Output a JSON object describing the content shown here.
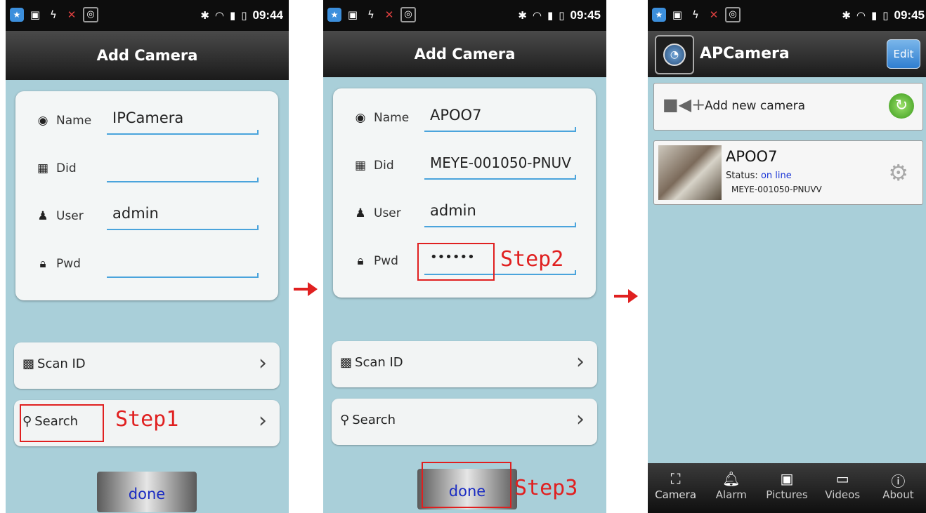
{
  "phone1": {
    "status_time": "09:44",
    "title": "Add Camera",
    "fields": [
      {
        "label": "Name",
        "value": "IPCamera"
      },
      {
        "label": "Did",
        "value": ""
      },
      {
        "label": "User",
        "value": "admin"
      },
      {
        "label": "Pwd",
        "value": ""
      }
    ],
    "scan_label": "Scan ID",
    "search_label": "Search",
    "done_label": "done",
    "step_label": "Step1"
  },
  "phone2": {
    "status_time": "09:45",
    "title": "Add Camera",
    "fields": [
      {
        "label": "Name",
        "value": "APOO7"
      },
      {
        "label": "Did",
        "value": "MEYE-001050-PNUV"
      },
      {
        "label": "User",
        "value": "admin"
      },
      {
        "label": "Pwd",
        "value": "••••••"
      }
    ],
    "scan_label": "Scan ID",
    "search_label": "Search",
    "done_label": "done",
    "step2_label": "Step2",
    "step3_label": "Step3"
  },
  "phone3": {
    "status_time": "09:45",
    "app_title": "APCamera",
    "edit_label": "Edit",
    "add_camera_label": "Add new camera",
    "camera": {
      "name": "APOO7",
      "status_label": "Status:",
      "status_value": "on line",
      "did": "MEYE-001050-PNUVV"
    },
    "tabs": [
      {
        "label": "Camera",
        "icon": "camera-icon"
      },
      {
        "label": "Alarm",
        "icon": "alarm-icon"
      },
      {
        "label": "Pictures",
        "icon": "pictures-icon"
      },
      {
        "label": "Videos",
        "icon": "videos-icon"
      },
      {
        "label": "About",
        "icon": "about-icon"
      }
    ]
  },
  "colors": {
    "screen_bg": "#a9cfd9",
    "annotation_red": "#e02020",
    "input_underline": "#4aa4dc",
    "done_text": "#1a2bc2"
  }
}
